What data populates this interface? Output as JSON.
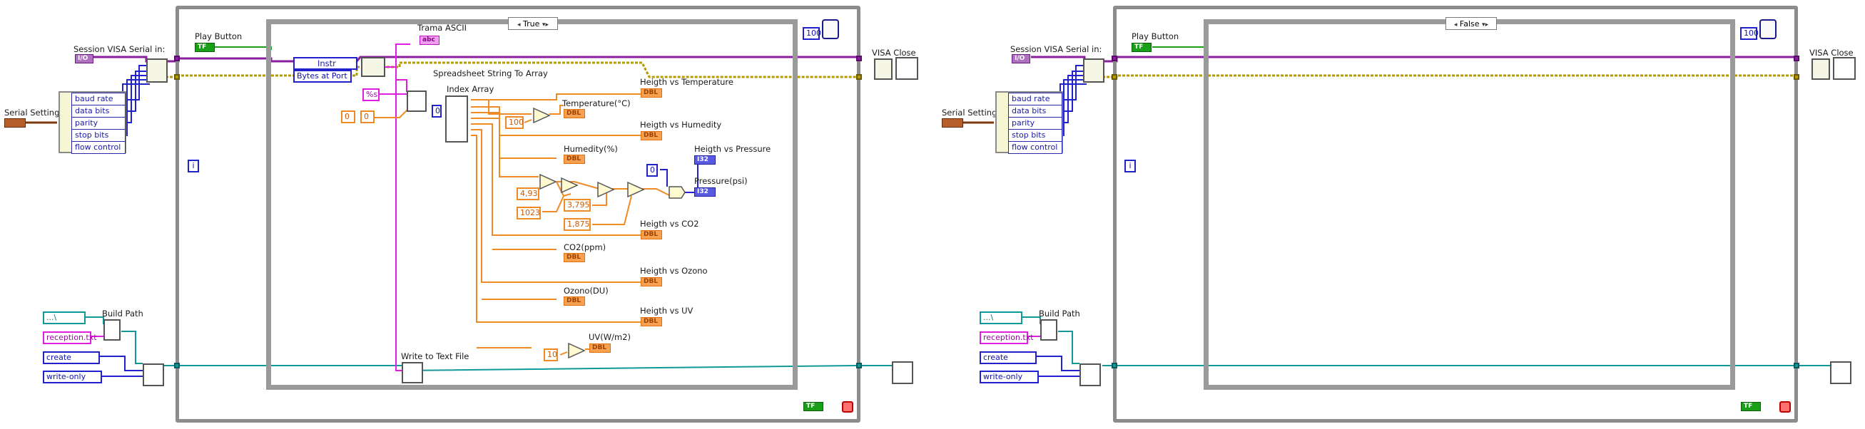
{
  "left_diagram": {
    "session_label": "Session VISA Serial in:",
    "play_label": "Play Button",
    "serial_label": "Serial Settings",
    "serial_items": [
      "baud rate",
      "data bits",
      "parity",
      "stop bits",
      "flow control"
    ],
    "case_selector": "True",
    "wait_value": "100",
    "visa_close_label": "VISA Close",
    "iteration": "i",
    "instr_label": "Instr",
    "bytes_label": "Bytes at Port",
    "trama_label": "Trama ASCII",
    "spreadsheet_label": "Spreadsheet String To Array",
    "format_value": "%s",
    "zero_a": "0",
    "zero_b": "0",
    "index_label": "Index Array",
    "index_value": "0",
    "const_100": "100",
    "temp_label": "Temperature(°C)",
    "hvt_label": "Heigth vs Temperature",
    "hvh_label": "Heigth vs Humedity",
    "hum_label": "Humedity(%)",
    "const_493": "4,93",
    "const_1023": "1023",
    "const_3795": "3,795",
    "const_1875": "1,875",
    "zero_pressure": "0",
    "hvp_label": "Heigth vs Pressure",
    "pressure_label": "Pressure(psi)",
    "hvco2_label": "Heigth vs CO2",
    "co2_label": "CO2(ppm)",
    "hvozono_label": "Heigth vs Ozono",
    "ozono_label": "Ozono(DU)",
    "hvuv_label": "Heigth vs UV",
    "uv_label": "UV(W/m2)",
    "const_10": "10",
    "write_label": "Write to Text File",
    "build_path_label": "Build Path",
    "path_value": "...\\",
    "filename_value": "reception.txt",
    "create_value": "create",
    "write_only_value": "write-only"
  },
  "right_diagram": {
    "session_label": "Session VISA Serial in:",
    "play_label": "Play Button",
    "serial_label": "Serial Settings",
    "serial_items": [
      "baud rate",
      "data bits",
      "parity",
      "stop bits",
      "flow control"
    ],
    "case_selector": "False",
    "wait_value": "100",
    "visa_close_label": "VISA Close",
    "iteration": "i",
    "build_path_label": "Build Path",
    "path_value": "...\\",
    "filename_value": "reception.txt",
    "create_value": "create",
    "write_only_value": "write-only"
  },
  "terminals": {
    "dbl": "DBL",
    "i32": "I32",
    "tf": "TF",
    "abc": "abc",
    "visa": "I/O"
  },
  "colors": {
    "orange_wire": "#f08a24",
    "pink_wire": "#e01ee0",
    "blue_wire": "#2222cc",
    "teal_wire": "#11999a",
    "purple_wire": "#8a1e9c",
    "error_wire": "#b59a00"
  }
}
